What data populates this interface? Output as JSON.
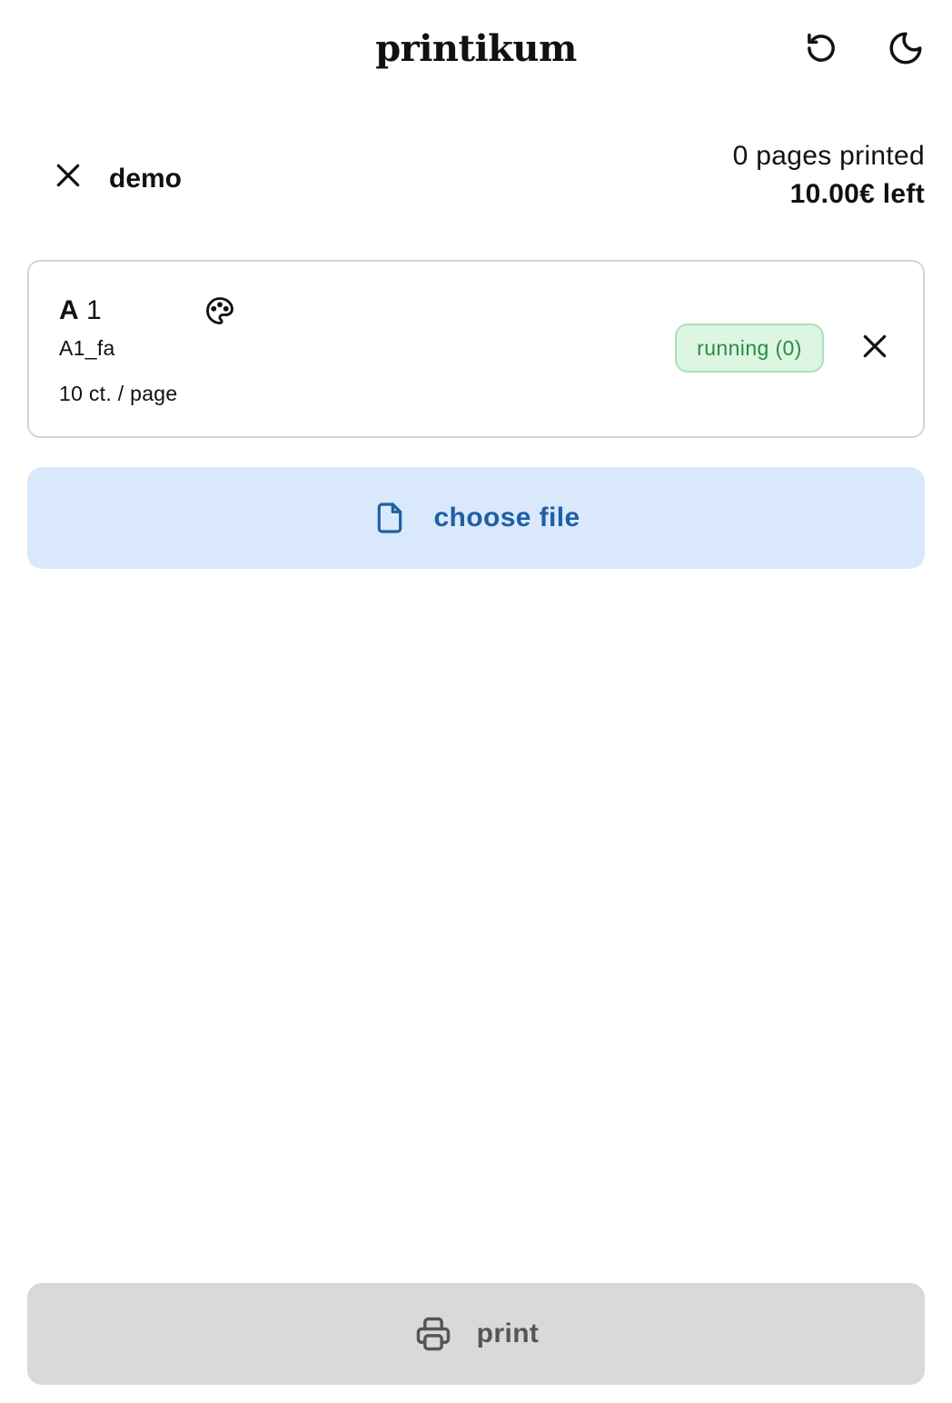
{
  "header": {
    "app_title": "printikum",
    "reload_icon": "reload-icon",
    "theme_icon": "moon-icon"
  },
  "session": {
    "logout_icon": "close-icon",
    "username": "demo",
    "pages_printed": "0 pages printed",
    "credit_left": "10.00€ left"
  },
  "printer": {
    "name_letter": "A",
    "name_number": "1",
    "color_icon": "palette-icon",
    "id": "A1_fa",
    "price": "10 ct. / page",
    "status": "running (0)",
    "status_color": "#2e8a46",
    "remove_icon": "close-icon"
  },
  "actions": {
    "choose_file_icon": "file-icon",
    "choose_file_label": "choose file",
    "choose_file_color": "#1f5fa6",
    "print_icon": "printer-icon",
    "print_label": "print"
  }
}
